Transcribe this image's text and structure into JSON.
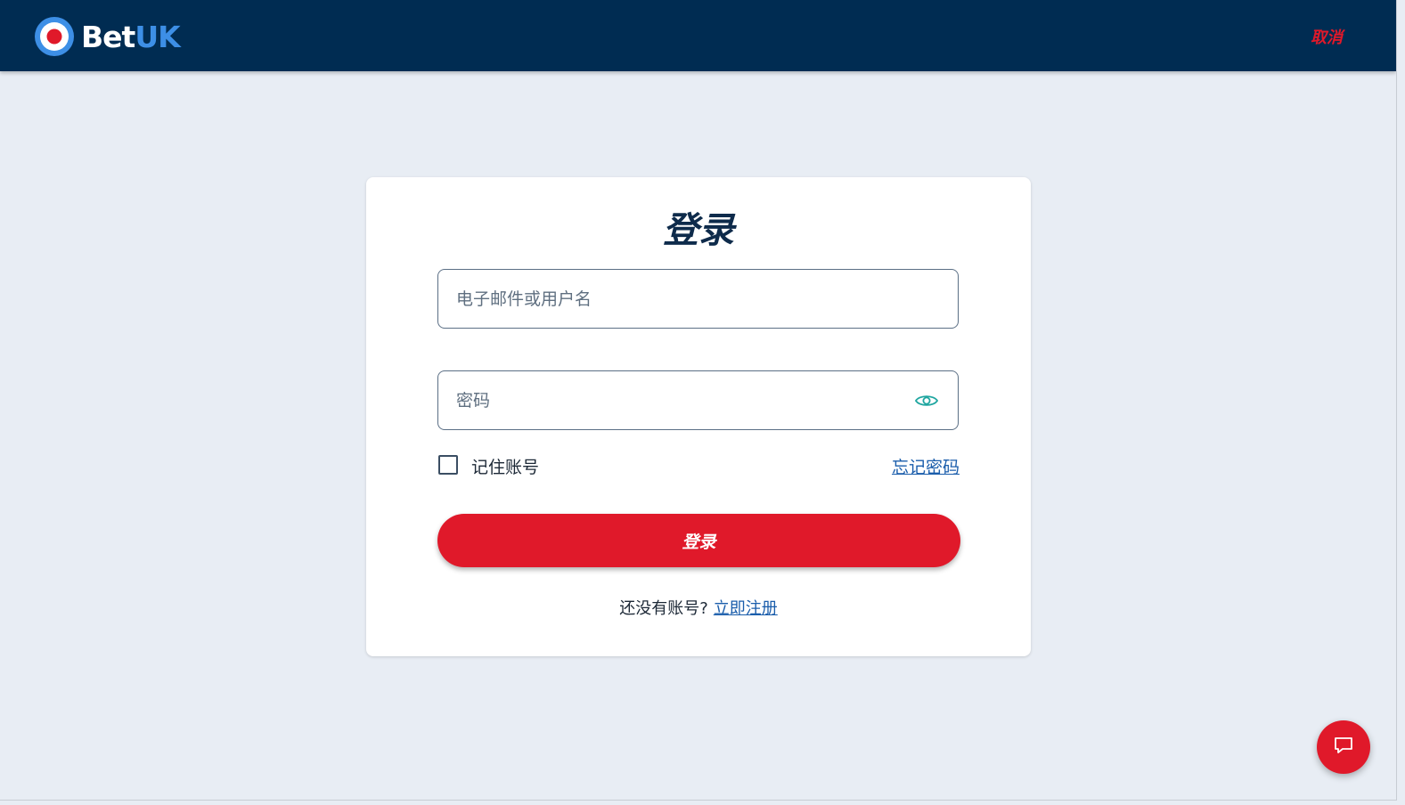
{
  "brand": {
    "name_part1": "Bet",
    "name_part2": "UK",
    "logo_icon": "target-roundel-icon",
    "colors": {
      "navy": "#002c52",
      "red": "#e0192a",
      "blue": "#3d8fe6"
    }
  },
  "header": {
    "cancel_label": "取消"
  },
  "login_form": {
    "title": "登录",
    "email_placeholder": "电子邮件或用户名",
    "password_placeholder": "密码",
    "password_toggle_icon": "eye-icon",
    "remember_label": "记住账号",
    "remember_checked": false,
    "forgot_label": "忘记密码",
    "submit_label": "登录",
    "no_account_text": "还没有账号?",
    "signup_link_label": "立即注册"
  },
  "chat": {
    "icon": "chat-bubble-icon"
  }
}
